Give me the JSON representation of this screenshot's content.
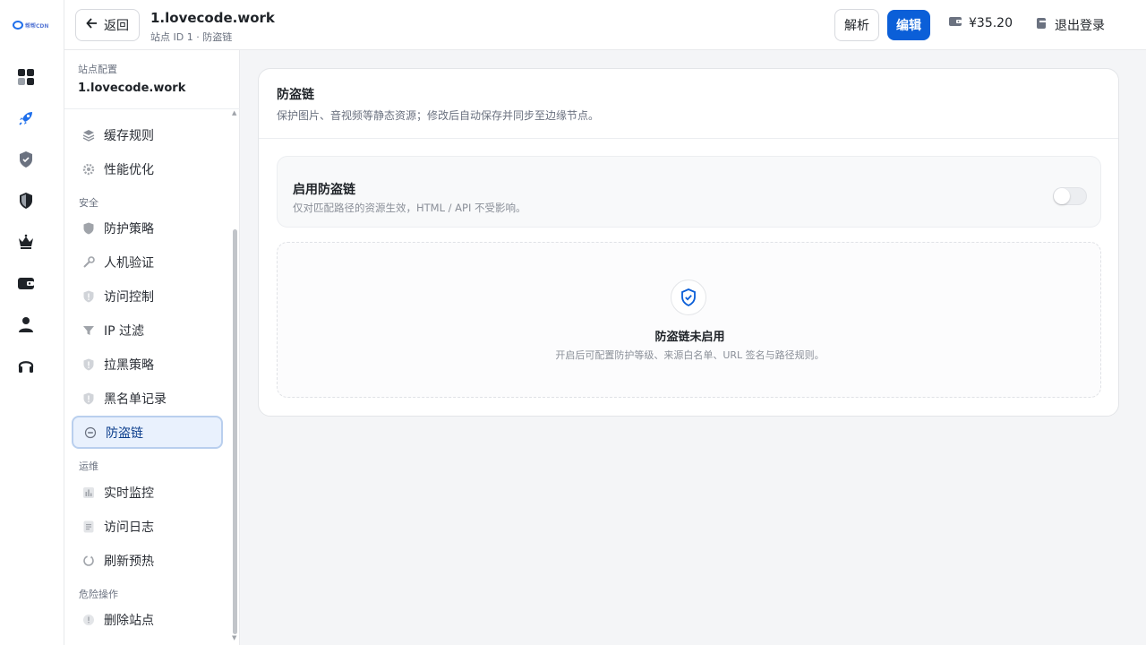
{
  "rail": {
    "logo_text": "帮帮CDN",
    "icons": [
      "dashboard-icon",
      "rocket-icon",
      "shield-check-icon",
      "shield-half-icon",
      "crown-icon",
      "wallet-icon",
      "user-icon",
      "headset-icon"
    ]
  },
  "topbar": {
    "back_label": "返回",
    "site_title": "1.lovecode.work",
    "site_subtitle": "站点 ID 1 · 防盗链",
    "resolve_label": "解析",
    "edit_label": "编辑",
    "balance": "¥35.20",
    "logout_label": "退出登录",
    "accent": "#0b5fd8"
  },
  "sidebar": {
    "header_label": "站点配置",
    "site_name": "1.lovecode.work",
    "groups": [
      {
        "label": "",
        "items": [
          {
            "label": "缓存规则",
            "icon": "layers-icon"
          },
          {
            "label": "性能优化",
            "icon": "gear-icon"
          }
        ]
      },
      {
        "label": "安全",
        "items": [
          {
            "label": "防护策略",
            "icon": "shield-icon"
          },
          {
            "label": "人机验证",
            "icon": "wrench-icon"
          },
          {
            "label": "访问控制",
            "icon": "shield-alert-icon"
          },
          {
            "label": "IP 过滤",
            "icon": "filter-icon"
          },
          {
            "label": "拉黑策略",
            "icon": "shield-alert-icon"
          },
          {
            "label": "黑名单记录",
            "icon": "shield-alert-icon"
          },
          {
            "label": "防盗链",
            "icon": "link-icon",
            "active": true
          }
        ]
      },
      {
        "label": "运维",
        "items": [
          {
            "label": "实时监控",
            "icon": "bar-chart-icon"
          },
          {
            "label": "访问日志",
            "icon": "document-icon"
          },
          {
            "label": "刷新预热",
            "icon": "refresh-icon"
          }
        ]
      },
      {
        "label": "危险操作",
        "items": [
          {
            "label": "删除站点",
            "icon": "alert-circle-icon"
          }
        ]
      }
    ]
  },
  "main": {
    "title": "防盗链",
    "description": "保护图片、音视频等静态资源；修改后自动保存并同步至边缘节点。",
    "toggle": {
      "title": "启用防盗链",
      "description": "仅对匹配路径的资源生效，HTML / API 不受影响。",
      "enabled": false
    },
    "empty": {
      "title": "防盗链未启用",
      "description": "开启后可配置防护等级、来源白名单、URL 签名与路径规则。"
    }
  }
}
